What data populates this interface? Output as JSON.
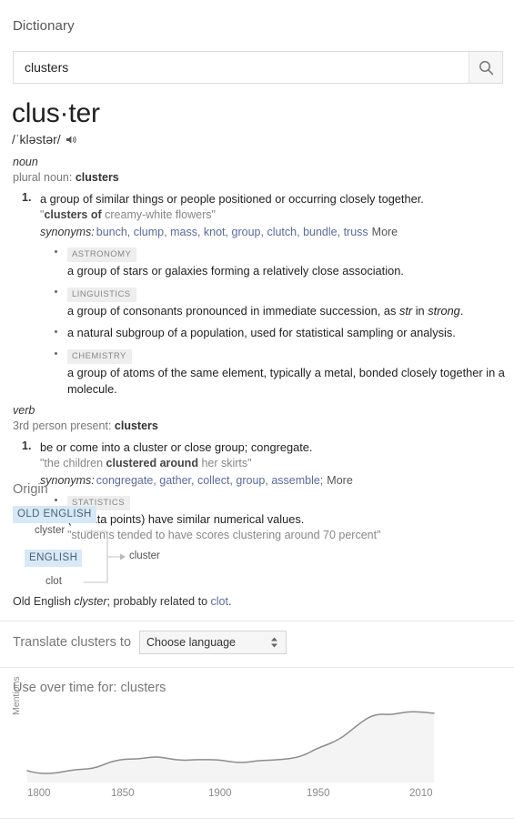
{
  "header": {
    "dictionary_label": "Dictionary"
  },
  "search": {
    "value": "clusters",
    "placeholder": "",
    "icon": "search-icon"
  },
  "entry": {
    "headword": "clus·ter",
    "phonetic": "/ˈkləstər/",
    "audio_icon": "speaker-icon",
    "parts_of_speech": [
      {
        "pos": "noun",
        "inflection_label": "plural noun:",
        "inflection_word": "clusters",
        "senses": [
          {
            "number": "1.",
            "gloss": "a group of similar things or people positioned or occurring closely together.",
            "example_prefix": "\"",
            "example_bold": "clusters of",
            "example_rest": " creamy-white flowers\"",
            "synonyms_label": "synonyms:",
            "synonyms": [
              "bunch,",
              "clump,",
              "mass,",
              "knot,",
              "group,",
              "clutch,",
              "bundle,",
              "truss"
            ],
            "more_label": "More",
            "subsenses": [
              {
                "tag": "ASTRONOMY",
                "gloss": "a group of stars or galaxies forming a relatively close association."
              },
              {
                "tag": "LINGUISTICS",
                "gloss_pre": "a group of consonants pronounced in immediate succession, as ",
                "gloss_italic1": "str",
                "gloss_mid": " in ",
                "gloss_italic2": "strong",
                "gloss_post": "."
              },
              {
                "tag": "",
                "gloss": "a natural subgroup of a population, used for statistical sampling or analysis."
              },
              {
                "tag": "CHEMISTRY",
                "gloss": "a group of atoms of the same element, typically a metal, bonded closely together in a molecule."
              }
            ]
          }
        ]
      },
      {
        "pos": "verb",
        "inflection_label": "3rd person present:",
        "inflection_word": "clusters",
        "senses": [
          {
            "number": "1.",
            "gloss": "be or come into a cluster or close group; congregate.",
            "example_prefix": "\"the children ",
            "example_bold": "clustered around",
            "example_rest": " her skirts\"",
            "synonyms_label": "synonyms:",
            "synonyms": [
              "congregate,",
              "gather,",
              "collect,",
              "group,",
              "assemble;"
            ],
            "more_label": "More",
            "subsenses": [
              {
                "tag": "STATISTICS",
                "gloss": "(of data points) have similar numerical values.",
                "example": "\"students tended to have scores clustering around 70 percent\""
              }
            ]
          }
        ]
      }
    ]
  },
  "origin": {
    "title": "Origin",
    "diagram": {
      "badge_old_english": "OLD ENGLISH",
      "word_clyster": "clyster",
      "badge_english": "ENGLISH",
      "word_clot": "clot",
      "target_word": "cluster"
    },
    "note_pre": "Old English ",
    "note_italic": "clyster",
    "note_mid": "; probably related to ",
    "note_link": "clot",
    "note_post": "."
  },
  "translate": {
    "label": "Translate clusters to",
    "selected": "Choose language",
    "options": [
      "Choose language"
    ]
  },
  "usage": {
    "title": "Use over time for: clusters"
  },
  "chart_data": {
    "type": "area",
    "title": "Use over time for: clusters",
    "xlabel": "",
    "ylabel": "Mentions",
    "grid": false,
    "legend": "none",
    "xlim": [
      1800,
      2019
    ],
    "ylim": [
      0,
      1
    ],
    "xticks": [
      1800,
      1850,
      1900,
      1950,
      2010
    ],
    "line_color": "#8c8c8c",
    "fill_color": "#f4f4f4",
    "x": [
      1800,
      1805,
      1810,
      1815,
      1820,
      1825,
      1830,
      1835,
      1840,
      1845,
      1850,
      1855,
      1860,
      1865,
      1870,
      1875,
      1880,
      1885,
      1890,
      1895,
      1900,
      1905,
      1910,
      1915,
      1920,
      1925,
      1930,
      1935,
      1940,
      1945,
      1950,
      1955,
      1960,
      1965,
      1970,
      1975,
      1980,
      1985,
      1990,
      1995,
      2000,
      2005,
      2010,
      2015,
      2019
    ],
    "y": [
      0.16,
      0.13,
      0.12,
      0.13,
      0.15,
      0.17,
      0.18,
      0.19,
      0.23,
      0.28,
      0.31,
      0.32,
      0.32,
      0.34,
      0.35,
      0.33,
      0.31,
      0.3,
      0.31,
      0.31,
      0.31,
      0.3,
      0.28,
      0.27,
      0.28,
      0.3,
      0.3,
      0.31,
      0.32,
      0.34,
      0.38,
      0.45,
      0.5,
      0.55,
      0.62,
      0.72,
      0.82,
      0.9,
      0.93,
      0.92,
      0.94,
      0.96,
      0.96,
      0.95,
      0.94
    ]
  }
}
